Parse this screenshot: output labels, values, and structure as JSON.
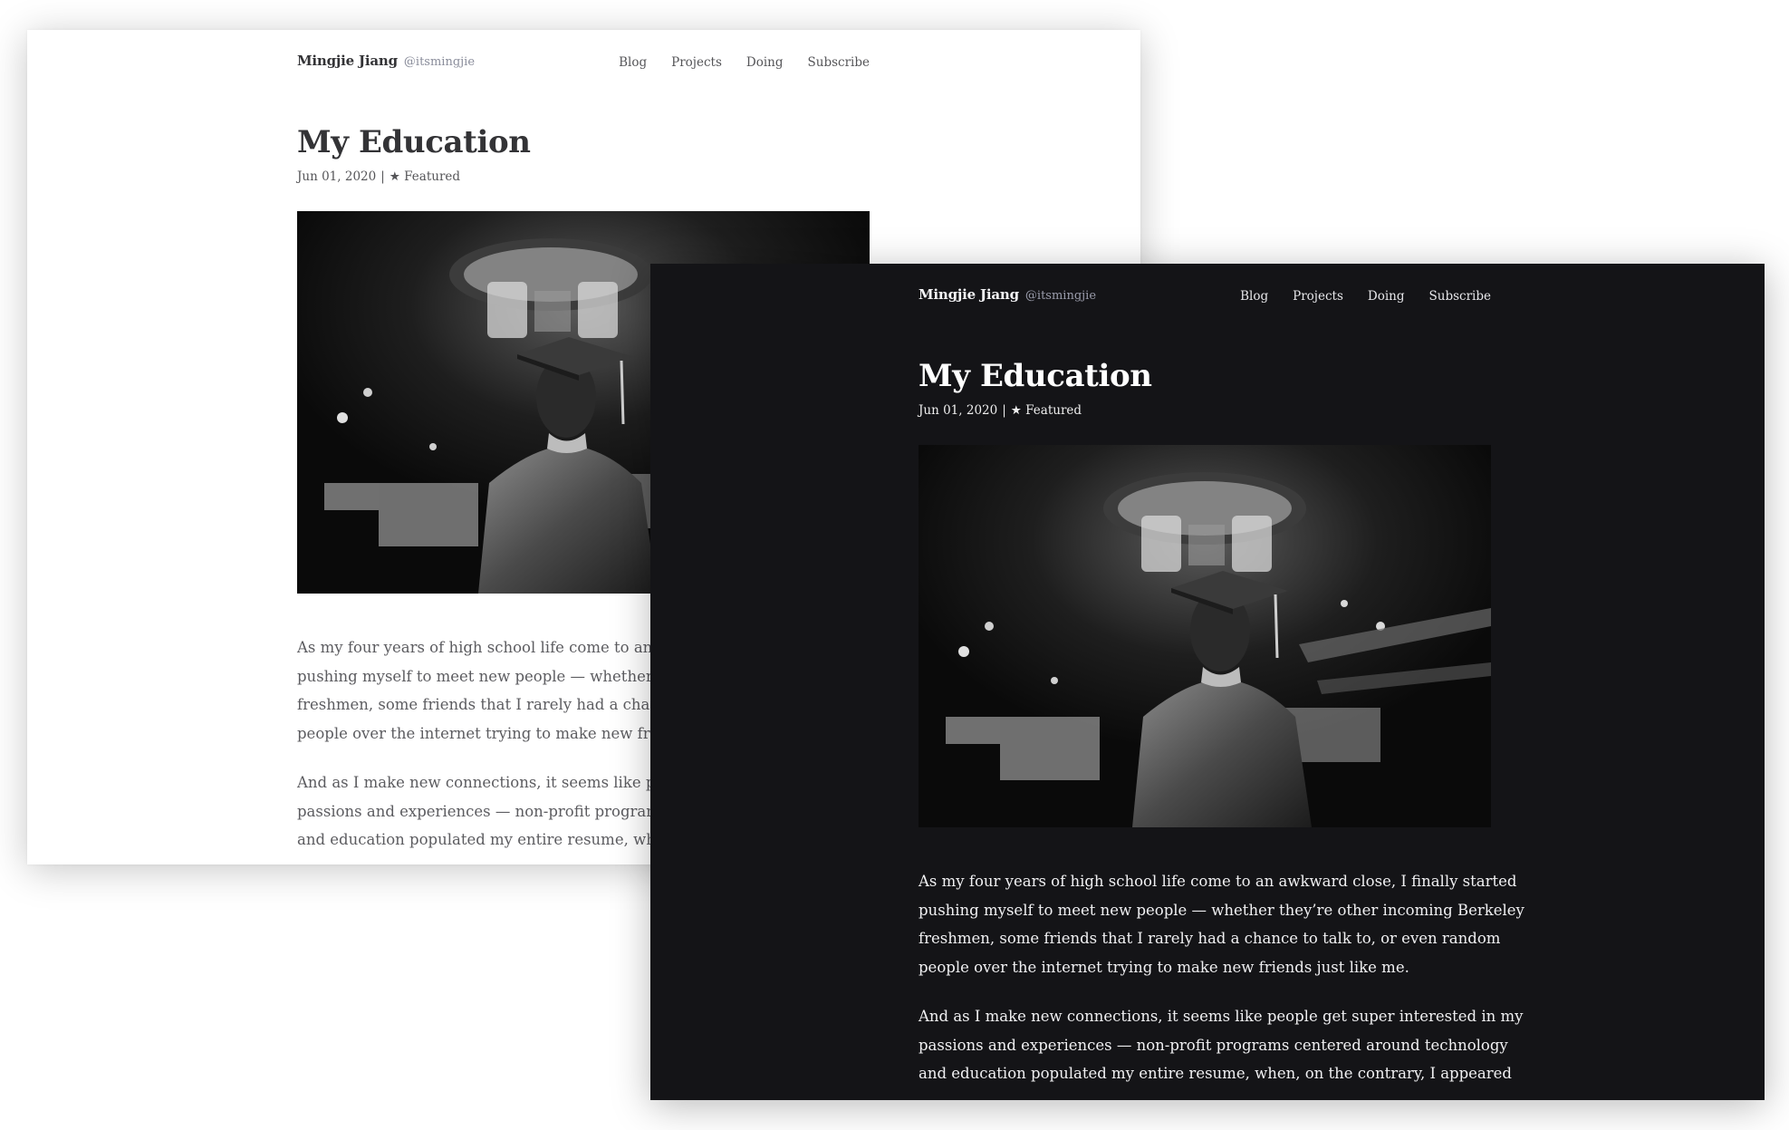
{
  "site": {
    "name": "Mingjie Jiang",
    "handle": "@itsmingjie",
    "nav": [
      "Blog",
      "Projects",
      "Doing",
      "Subscribe"
    ]
  },
  "post": {
    "title": "My Education",
    "date": "Jun 01, 2020",
    "separator": "|",
    "tag": "★ Featured",
    "paragraphs": [
      [
        "As my four years of high school life come to an awkward close, I finally started",
        "pushing myself to meet new people — whether they’re other incoming Berkeley",
        "freshmen, some friends that I rarely had a chance to talk to, or even random",
        "people over the internet trying to make new friends just like me."
      ],
      [
        "And as I make new connections, it seems like people get super interested in my",
        "passions and experiences — non-profit programs centered around technology",
        "and education populated my entire resume, when, on the contrary, I appeared"
      ]
    ]
  },
  "themes": {
    "light": {
      "background": "#ffffff",
      "text": "#333336"
    },
    "dark": {
      "background": "#141417",
      "text": "#ffffff"
    }
  }
}
